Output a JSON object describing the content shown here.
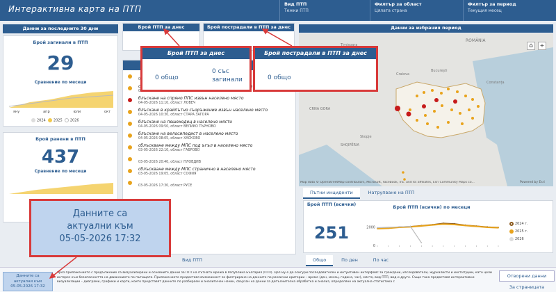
{
  "header": {
    "title": "Интерактивна карта на ПТП",
    "items": [
      {
        "label": "Вид ПТП",
        "value": "Тежки ПТП"
      },
      {
        "label": "Филтър за област",
        "value": "Цялата страна"
      },
      {
        "label": "Филтър за период",
        "value": "Текущия месец"
      }
    ]
  },
  "left": {
    "title": "Данни за последните 30 дни",
    "killed": {
      "label": "Брой загинали в ПТП",
      "value": "29",
      "compare": "Сравнение по месеци",
      "months": [
        "яну",
        "апр",
        "юли",
        "окт"
      ]
    },
    "injured": {
      "label": "Брой ранени в ПТП",
      "value": "437",
      "compare": "Сравнение по месеци",
      "months": [
        "яну",
        "апр",
        "юли",
        "окт"
      ]
    },
    "legend": [
      "2024",
      "2025",
      "2026"
    ]
  },
  "today": {
    "count_title": "Брой ПТП за днес",
    "victims_title": "Брой пострадали в ПТП за днес",
    "count_total": "0 общо",
    "count_killed": "0 със загинали",
    "victims_total": "0 общо"
  },
  "list": {
    "items": [
      {
        "text": "",
        "date": "04-05-2026 14:10, област РУСЕ"
      },
      {
        "text": "сблъскване между МПС под ъгъл в населено място",
        "date": "04-05-2026 12:15, област ВАРНА"
      },
      {
        "text": "блъскане на спряно ППС извън населено място",
        "date": "04-05-2026 11:10, област ЛОВЕЧ"
      },
      {
        "text": "блъскане в крайпътно съоръжение извън населено място",
        "date": "04-05-2026 10:30, област СТАРА ЗАГОРА"
      },
      {
        "text": "блъскане на пешеходец в населено място",
        "date": "04-05-2026 09:50, област ВЕЛИКО ТЪРНОВО"
      },
      {
        "text": "блъскане на велосипедист в населено място",
        "date": "04-05-2026 08:05, област ХАСКОВО"
      },
      {
        "text": "сблъскване между МПС под ъгъл в населено място",
        "date": "03-05-2026 22:10, област ГАБРОВО"
      },
      {
        "text": "",
        "date": "03-05-2026 20:40, област ПЛОВДИВ"
      },
      {
        "text": "сблъскване между МПС странично в населено място",
        "date": "03-05-2026 19:05, област СОФИЯ"
      },
      {
        "text": "",
        "date": "03-05-2026 17:30, област РУСЕ"
      }
    ],
    "colors": [
      "#e8a31c",
      "#e8a31c",
      "#c61b1b",
      "#e8a31c",
      "#e8a31c",
      "#e8a31c",
      "#e8a31c",
      "#e8a31c",
      "#e8a31c",
      "#e8a31c"
    ],
    "bottom_label": "Вид ПТП"
  },
  "map": {
    "title": "Данни за избрания период",
    "labels": {
      "romania": "ROMÂNIA",
      "timisoara": "Timișoara",
      "craiova": "Craiova",
      "bucuresti": "București",
      "constanta": "Constanța",
      "crna_gora": "CRNA GORA",
      "skopje": "Skopje",
      "shqiperia": "SHQIPËRIA"
    },
    "attribution": "Map data © OpenStreetMap contributors, Microsoft, Facebook, Inc. and its affiliates, Esri Community Maps co...",
    "esri": "Powered by Esri",
    "tabs": [
      "Пътни инциденти",
      "Натрупване на ПТП"
    ]
  },
  "bottom": {
    "count_title": "Брой ПТП (всички)",
    "count_value": "251",
    "chart_title": "Брой ПТП (всички) по месеци",
    "tabs": [
      "Общо",
      "По ден",
      "По час"
    ],
    "legend": [
      "2024 г.",
      "2025 г.",
      "2026"
    ]
  },
  "chart_data": {
    "type": "line",
    "title": "Брой ПТП (всички) по месеци",
    "categories": [
      "яну",
      "фев",
      "мар",
      "апр",
      "май",
      "юни",
      "юли",
      "авг",
      "сеп",
      "окт",
      "ное",
      "дек"
    ],
    "series": [
      {
        "name": "2024 г.",
        "values": [
          1850,
          1900,
          2000,
          2050,
          2150,
          2250,
          2400,
          2350,
          2200,
          2100,
          2000,
          1950
        ]
      },
      {
        "name": "2025 г.",
        "values": [
          1800,
          1850,
          1950,
          2000,
          2100,
          2200,
          2300,
          2250,
          2150,
          2050,
          1950,
          1900
        ]
      },
      {
        "name": "2026",
        "values": [
          1900,
          1950,
          2000,
          2050,
          300
        ]
      }
    ],
    "yticks": [
      "2000",
      "0"
    ],
    "ylim": [
      0,
      3000
    ],
    "colors": [
      "#8b5a1e",
      "#e8a31c",
      "#bdbdbd"
    ]
  },
  "updated": {
    "big": "Данните са актуални към 05-05-2026 17:32",
    "big_l1": "Данните са",
    "big_l2": "актуални към",
    "big_l3": "05-05-2026 17:32",
    "small_l1": "Данните са",
    "small_l2": "актуални към",
    "small_l3": "05-05-2026 17:32"
  },
  "footer": {
    "text": "Чрез приложението с продължение са визуализирани и основните данни за ПТП на пътната мрежа в Република България (ПТП). Цел му е да осигури последователен и интуитивен интерфейс за граждани, изследователи, журналисти и институции, като цели интерес към безопасността на движението по пътищата. Приложението предоставя възможност за филтриране на данните по различни критерии – време (ден, месец, година, час), място, вид ПТП, вид и друге. Също така предоставя интерактивни визуализации – диаграми, графики и карти, които представят данните по разбираем и аналитичен начин, свързан на данни за допълнителна обработка и анализ, определяне на актуална статистика с",
    "open_data": "Отворени данни",
    "page_link": "За страницата"
  }
}
